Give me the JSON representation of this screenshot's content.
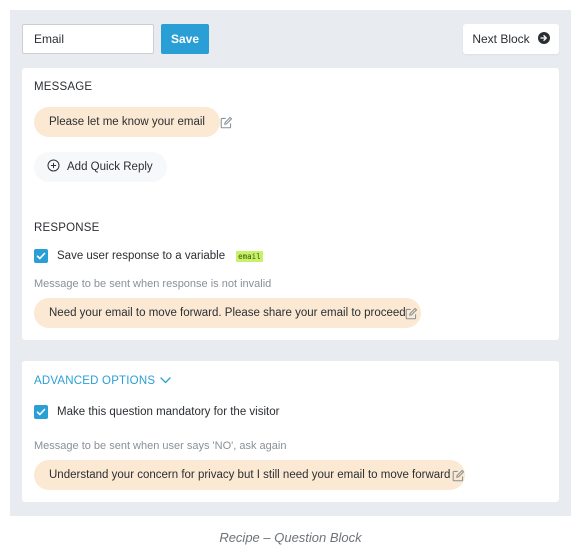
{
  "header": {
    "block_name_value": "Email",
    "save_label": "Save",
    "next_block_label": "Next Block"
  },
  "message_section": {
    "label": "MESSAGE",
    "message_text": "Please let me know your email",
    "add_quick_reply_label": "Add Quick Reply"
  },
  "response_section": {
    "label": "RESPONSE",
    "save_variable_label": "Save user response to a variable",
    "save_variable_checked": true,
    "variable_tag": "email",
    "invalid_hint": "Message to be sent when response is not invalid",
    "invalid_message": "Need your email to move forward. Please share your email to proceed"
  },
  "advanced_section": {
    "label": "ADVANCED OPTIONS",
    "mandatory_label": "Make this question mandatory for the visitor",
    "mandatory_checked": true,
    "no_hint": "Message to be sent when user says 'NO', ask again",
    "no_message": "Understand your concern for privacy but I still need your email to move forward"
  },
  "caption": "Recipe – Question Block",
  "colors": {
    "accent": "#2a9fd6",
    "bubble": "#fbe9d3",
    "frame_bg": "#e8ecf0",
    "variable_tag": "#c8f06a"
  },
  "icons": {
    "next": "arrow-circle-right-icon",
    "edit": "edit-icon",
    "add": "plus-circle-icon",
    "checkbox": "checkmark-icon",
    "expand": "chevron-down-icon"
  }
}
